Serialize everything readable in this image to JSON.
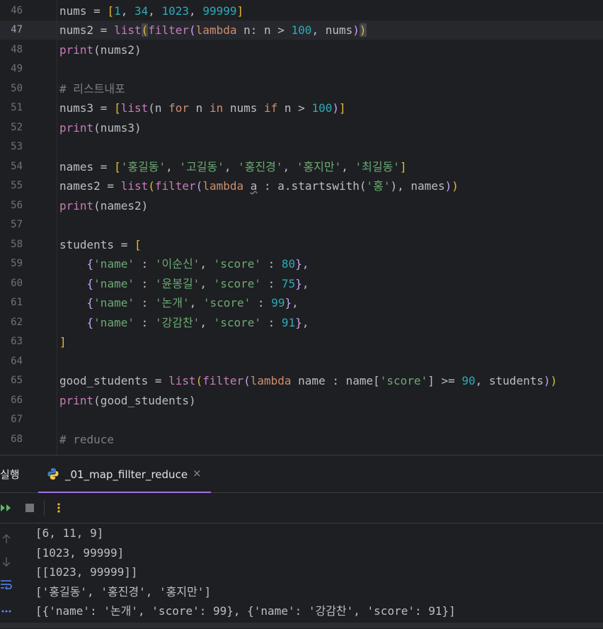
{
  "editor": {
    "line_numbers": [
      "46",
      "47",
      "48",
      "49",
      "50",
      "51",
      "52",
      "53",
      "54",
      "55",
      "56",
      "57",
      "58",
      "59",
      "60",
      "61",
      "62",
      "63",
      "64",
      "65",
      "66",
      "67",
      "68"
    ],
    "l46": {
      "a": "nums = ",
      "b": "[",
      "c": "1",
      ",1": ", ",
      "d": "34",
      ",2": ", ",
      "e": "1023",
      ",3": ", ",
      "f": "99999",
      "g": "]"
    },
    "l47": {
      "a": "nums2 = ",
      "b": "list",
      "c": "(",
      "d": "filter",
      "e": "(",
      "f": "lambda",
      " g": " n: n > ",
      "h": "100",
      "i": ", nums",
      "j": ")",
      "k": ")"
    },
    "l48": {
      "a": "print",
      "b": "(nums2)"
    },
    "l50": {
      "a": "# 리스트내포"
    },
    "l51": {
      "a": "nums3 = ",
      "b": "[",
      "c": "list",
      "d": "(n ",
      "e": "for",
      " f": " n ",
      "g": "in",
      " h": " nums ",
      "i": "if",
      " j": " n > ",
      "k": "100",
      "l": ")",
      "m": "]"
    },
    "l52": {
      "a": "print",
      "b": "(nums3)"
    },
    "l54": {
      "a": "names = ",
      "b": "[",
      "c": "'홍길동'",
      "d": ", ",
      "e": "'고길동'",
      "f": ", ",
      "g": "'홍진경'",
      "h": ", ",
      "i": "'홍지만'",
      "j": ", ",
      "k": "'최길동'",
      "l": "]"
    },
    "l55": {
      "a": "names2 = ",
      "b": "list",
      "c": "(",
      "d": "filter",
      "e": "(",
      "f": "lambda",
      "g": " ",
      "h": "a",
      "i": " : a.startswith(",
      "j": "'홍'",
      "k": "), names",
      "l": ")",
      "m": ")"
    },
    "l56": {
      "a": "print",
      "b": "(names2)"
    },
    "l58": {
      "a": "students = ",
      "b": "["
    },
    "l59": {
      "a": "    {",
      "b": "'name'",
      "c": " : ",
      "d": "'이순신'",
      "e": ", ",
      "f": "'score'",
      "g": " : ",
      "h": "80",
      "i": "},"
    },
    "l60": {
      "a": "    {",
      "b": "'name'",
      "c": " : ",
      "d": "'윤봉길'",
      "e": ", ",
      "f": "'score'",
      "g": " : ",
      "h": "75",
      "i": "},"
    },
    "l61": {
      "a": "    {",
      "b": "'name'",
      "c": " : ",
      "d": "'논개'",
      "e": ", ",
      "f": "'score'",
      "g": " : ",
      "h": "99",
      "i": "},"
    },
    "l62": {
      "a": "    {",
      "b": "'name'",
      "c": " : ",
      "d": "'강감찬'",
      "e": ", ",
      "f": "'score'",
      "g": " : ",
      "h": "91",
      "i": "},"
    },
    "l63": {
      "a": "]"
    },
    "l65": {
      "a": "good_students = ",
      "b": "list",
      "c": "(",
      "d": "filter",
      "e": "(",
      "f": "lambda",
      "g": " name : name[",
      "h": "'score'",
      "i": "] >= ",
      "j": "90",
      "k": ", students",
      "l": ")",
      "m": ")"
    },
    "l66": {
      "a": "print",
      "b": "(good_students)"
    },
    "l68": {
      "a": "# reduce"
    }
  },
  "run_panel": {
    "title": "실행",
    "tab_label": "_01_map_fillter_reduce",
    "tab_close": "×",
    "output": [
      "[6, 11, 9]",
      "[1023, 99999]",
      "[[1023, 99999]]",
      "['홍길동', '홍진경', '홍지만']",
      "[{'name': '논개', 'score': 99}, {'name': '강감찬', 'score': 91}]"
    ]
  },
  "colors": {
    "keyword": "#cf8e6d",
    "builtin": "#c77dbb",
    "number": "#2aacb8",
    "string": "#6aab73",
    "comment": "#7a7e85",
    "tab_underline": "#a571e6"
  }
}
